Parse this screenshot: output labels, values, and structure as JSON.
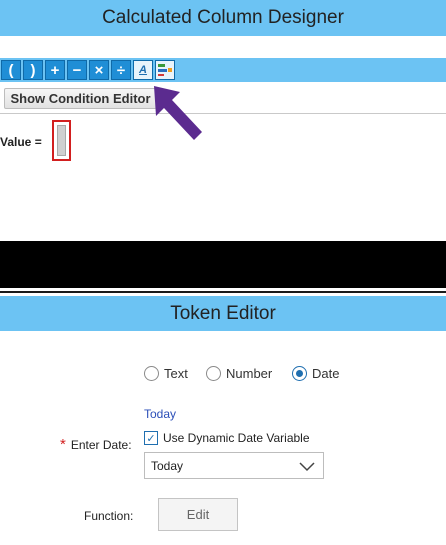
{
  "designer": {
    "title": "Calculated Column Designer",
    "show_condition_label": "Show Condition Editor",
    "value_label": "Value ="
  },
  "toolbar": {
    "buttons": [
      {
        "icon": "open-paren-icon",
        "glyph": "("
      },
      {
        "icon": "close-paren-icon",
        "glyph": ")"
      },
      {
        "icon": "plus-icon",
        "glyph": "+"
      },
      {
        "icon": "minus-icon",
        "glyph": "−"
      },
      {
        "icon": "multiply-icon",
        "glyph": "×"
      },
      {
        "icon": "divide-icon",
        "glyph": "÷"
      },
      {
        "icon": "token-icon",
        "glyph": "A"
      },
      {
        "icon": "ml-icon",
        "glyph": ""
      }
    ]
  },
  "token_editor": {
    "title": "Token Editor",
    "type_options": [
      "Text",
      "Number",
      "Date"
    ],
    "selected_type": "Date",
    "today_link": "Today",
    "enter_date_label": "Enter Date:",
    "required_mark": "*",
    "dynamic_checkbox_label": "Use Dynamic Date Variable",
    "dynamic_checked": true,
    "date_variable_value": "Today",
    "function_label": "Function:",
    "edit_label": "Edit"
  },
  "colors": {
    "header": "#6cc3f3",
    "toolbar_button": "#1f8ed6",
    "accent_arrow": "#5b2b8f",
    "required": "#d21f1f"
  }
}
